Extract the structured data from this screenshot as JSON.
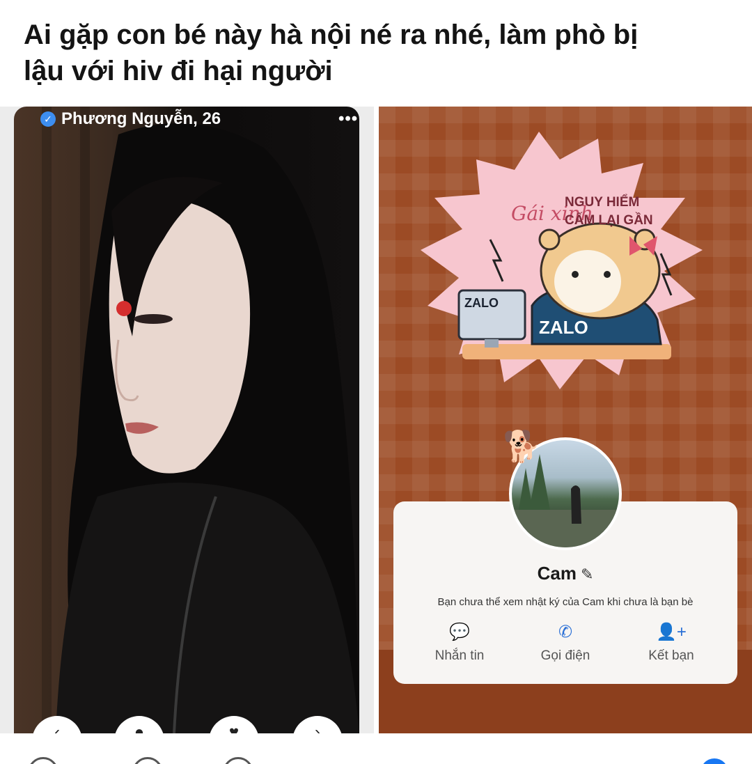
{
  "post": {
    "text_line1": "Ai gặp con bé này hà nội né ra nhé, làm phò bị",
    "text_line2": "lậu với hiv đi hại người"
  },
  "left_screenshot": {
    "profile_name": "Phương Nguyễn, 26",
    "verified_icon": "check",
    "more_icon": "•••",
    "action_buttons": [
      "‹",
      "●",
      "♥",
      "›"
    ]
  },
  "right_screenshot": {
    "sticker": {
      "title": "Gái xinh",
      "line1": "NGUY HIỂM",
      "line2": "CẤM LẠI GẦN",
      "monitor_text": "ZALO",
      "shirt_text": "ZALO"
    },
    "profile": {
      "name": "Cam",
      "edit_icon": "✎",
      "notice": "Bạn chưa thể xem nhật ký của Cam khi chưa là bạn bè",
      "actions": [
        {
          "icon": "💬",
          "label": "Nhắn tin"
        },
        {
          "icon": "✆",
          "label": "Gọi điện"
        },
        {
          "icon": "👤+",
          "label": "Kết bạn"
        }
      ]
    }
  },
  "colors": {
    "zalo_bg": "#9c4b25",
    "accent_blue": "#2a6fd6",
    "sticker_pink": "#f7c6cf"
  }
}
